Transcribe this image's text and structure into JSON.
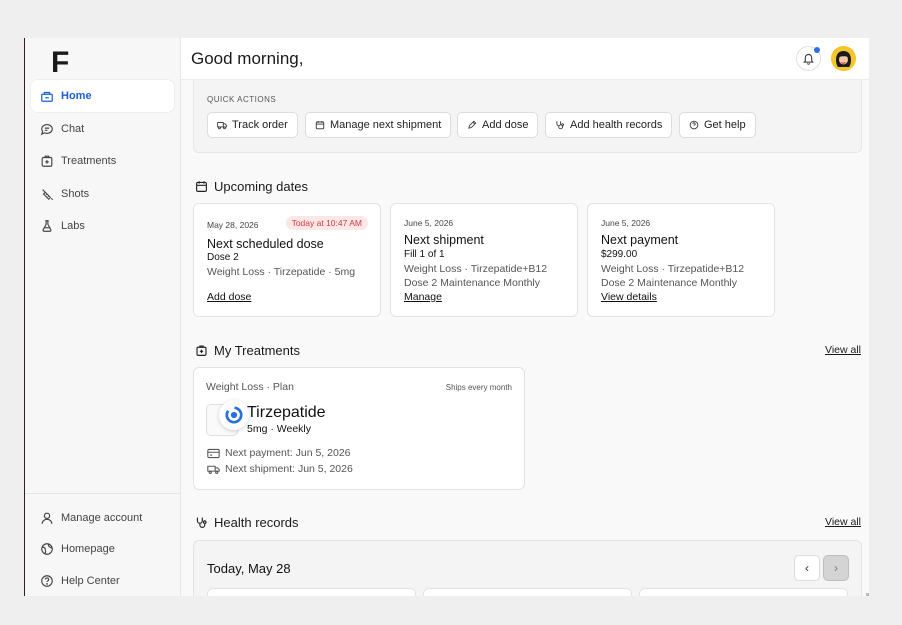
{
  "brand": {
    "logo_text": "F"
  },
  "sidebar": {
    "items": [
      {
        "label": "Home",
        "icon": "home-icon",
        "active": true
      },
      {
        "label": "Chat",
        "icon": "chat-icon"
      },
      {
        "label": "Treatments",
        "icon": "treatments-icon"
      },
      {
        "label": "Shots",
        "icon": "syringe-icon"
      },
      {
        "label": "Labs",
        "icon": "flask-icon"
      }
    ],
    "bottom_items": [
      {
        "label": "Manage account",
        "icon": "user-icon"
      },
      {
        "label": "Homepage",
        "icon": "globe-icon"
      },
      {
        "label": "Help Center",
        "icon": "help-icon"
      }
    ]
  },
  "header": {
    "greeting": "Good morning,"
  },
  "quick_actions": {
    "title": "QUICK ACTIONS",
    "buttons": [
      {
        "label": "Track order",
        "icon": "truck-icon"
      },
      {
        "label": "Manage next shipment",
        "icon": "calendar-icon"
      },
      {
        "label": "Add dose",
        "icon": "pen-icon"
      },
      {
        "label": "Add health records",
        "icon": "stethoscope-icon"
      },
      {
        "label": "Get help",
        "icon": "help-icon"
      }
    ]
  },
  "upcoming": {
    "title": "Upcoming dates",
    "cards": [
      {
        "date": "May 28, 2026",
        "badge": "Today at 10:47 AM",
        "title": "Next scheduled dose",
        "subtitle": "Dose 2",
        "meta": [
          "Weight Loss · Tirzepatide · 5mg"
        ],
        "action": "Add dose"
      },
      {
        "date": "June 5, 2026",
        "title": "Next shipment",
        "subtitle": "Fill 1 of 1",
        "meta": [
          "Weight Loss · Tirzepatide+B12",
          "Dose 2 Maintenance Monthly"
        ],
        "action": "Manage"
      },
      {
        "date": "June 5, 2026",
        "title": "Next payment",
        "subtitle": "$299.00",
        "meta": [
          "Weight Loss · Tirzepatide+B12",
          "Dose 2 Maintenance Monthly"
        ],
        "action": "View details"
      }
    ]
  },
  "treatments": {
    "title": "My Treatments",
    "view_all": "View all",
    "card": {
      "plan": "Weight Loss · Plan",
      "ships": "Ships every month",
      "name": "Tirzepatide",
      "dose": "5mg · Weekly",
      "next_payment": "Next payment: Jun 5, 2026",
      "next_shipment": "Next shipment: Jun 5, 2026"
    }
  },
  "health_records": {
    "title": "Health records",
    "view_all": "View all",
    "today": "Today, May 28"
  },
  "colors": {
    "accent": "#1c5fd6",
    "badge_bg": "#fde7e7",
    "badge_text": "#d23b3b",
    "notify_dot": "#2f6fe6",
    "avatar_bg": "#f6c52c"
  }
}
